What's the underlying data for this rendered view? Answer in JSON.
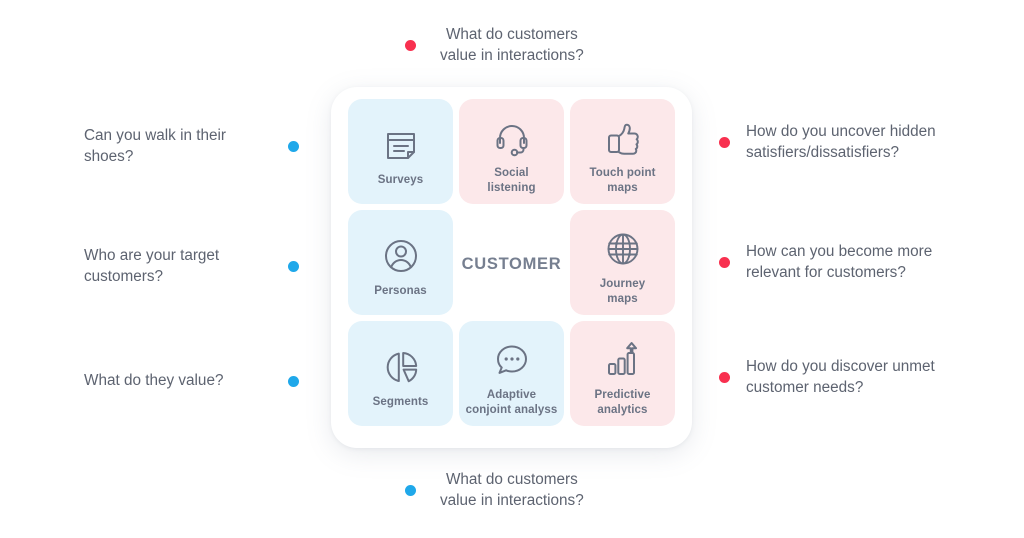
{
  "diagram": {
    "center_label": "CUSTOMER",
    "colors": {
      "dot_red": "#f8304f",
      "dot_blue": "#1fa8ea",
      "tile_blue": "#e3f3fb",
      "tile_pink": "#fce8ea",
      "icon_stroke": "#6b7384",
      "text": "#5d6370",
      "card_background": "#ffffff",
      "page_background": "#ffffff"
    },
    "tiles": [
      {
        "id": "surveys",
        "label": "Surveys",
        "icon": "document-icon",
        "tone": "blue"
      },
      {
        "id": "social-listening",
        "label": "Social\nlistening",
        "icon": "headset-icon",
        "tone": "pink"
      },
      {
        "id": "touch-point-maps",
        "label": "Touch point\nmaps",
        "icon": "thumbs-up-icon",
        "tone": "pink"
      },
      {
        "id": "personas",
        "label": "Personas",
        "icon": "user-circle-icon",
        "tone": "blue"
      },
      {
        "id": "customer-center",
        "label": "CUSTOMER",
        "icon": "none",
        "tone": "none"
      },
      {
        "id": "journey-maps",
        "label": "Journey\nmaps",
        "icon": "globe-icon",
        "tone": "pink"
      },
      {
        "id": "segments",
        "label": "Segments",
        "icon": "pie-chart-icon",
        "tone": "blue"
      },
      {
        "id": "adaptive-conjoint",
        "label": "Adaptive\nconjoint analyss",
        "icon": "speech-bubble-icon",
        "tone": "blue"
      },
      {
        "id": "predictive-analytics",
        "label": "Predictive\nanalytics",
        "icon": "bar-chart-up-icon",
        "tone": "pink"
      }
    ],
    "callouts": {
      "top": {
        "text": "What do customers\nvalue in interactions?",
        "dot_color": "red"
      },
      "bottom": {
        "text": "What do customers\nvalue in interactions?",
        "dot_color": "blue"
      },
      "left": [
        {
          "text": "Can you walk in their\nshoes?",
          "dot_color": "blue"
        },
        {
          "text": "Who are your target\ncustomers?",
          "dot_color": "blue"
        },
        {
          "text": "What do they value?",
          "dot_color": "blue"
        }
      ],
      "right": [
        {
          "text": "How do you uncover hidden\nsatisfiers/dissatisfiers?",
          "dot_color": "red"
        },
        {
          "text": "How can you become more\nrelevant for customers?",
          "dot_color": "red"
        },
        {
          "text": "How do you discover unmet\ncustomer needs?",
          "dot_color": "red"
        }
      ]
    }
  }
}
